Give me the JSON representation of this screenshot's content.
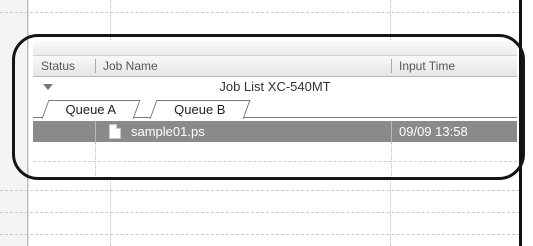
{
  "job_list": {
    "columns": [
      {
        "label": "Status"
      },
      {
        "label": "Job Name"
      },
      {
        "label": "Input Time"
      }
    ],
    "group_title": "Job List XC-540MT",
    "tabs": [
      {
        "label": "Queue A",
        "active": true
      },
      {
        "label": "Queue B",
        "active": false
      }
    ],
    "jobs": [
      {
        "name": "sample01.ps",
        "input_time": "09/09 13:58",
        "selected": true,
        "icon": "document-icon"
      }
    ]
  },
  "colors": {
    "selection": "#8a8a8a",
    "callout_border": "#151515"
  }
}
